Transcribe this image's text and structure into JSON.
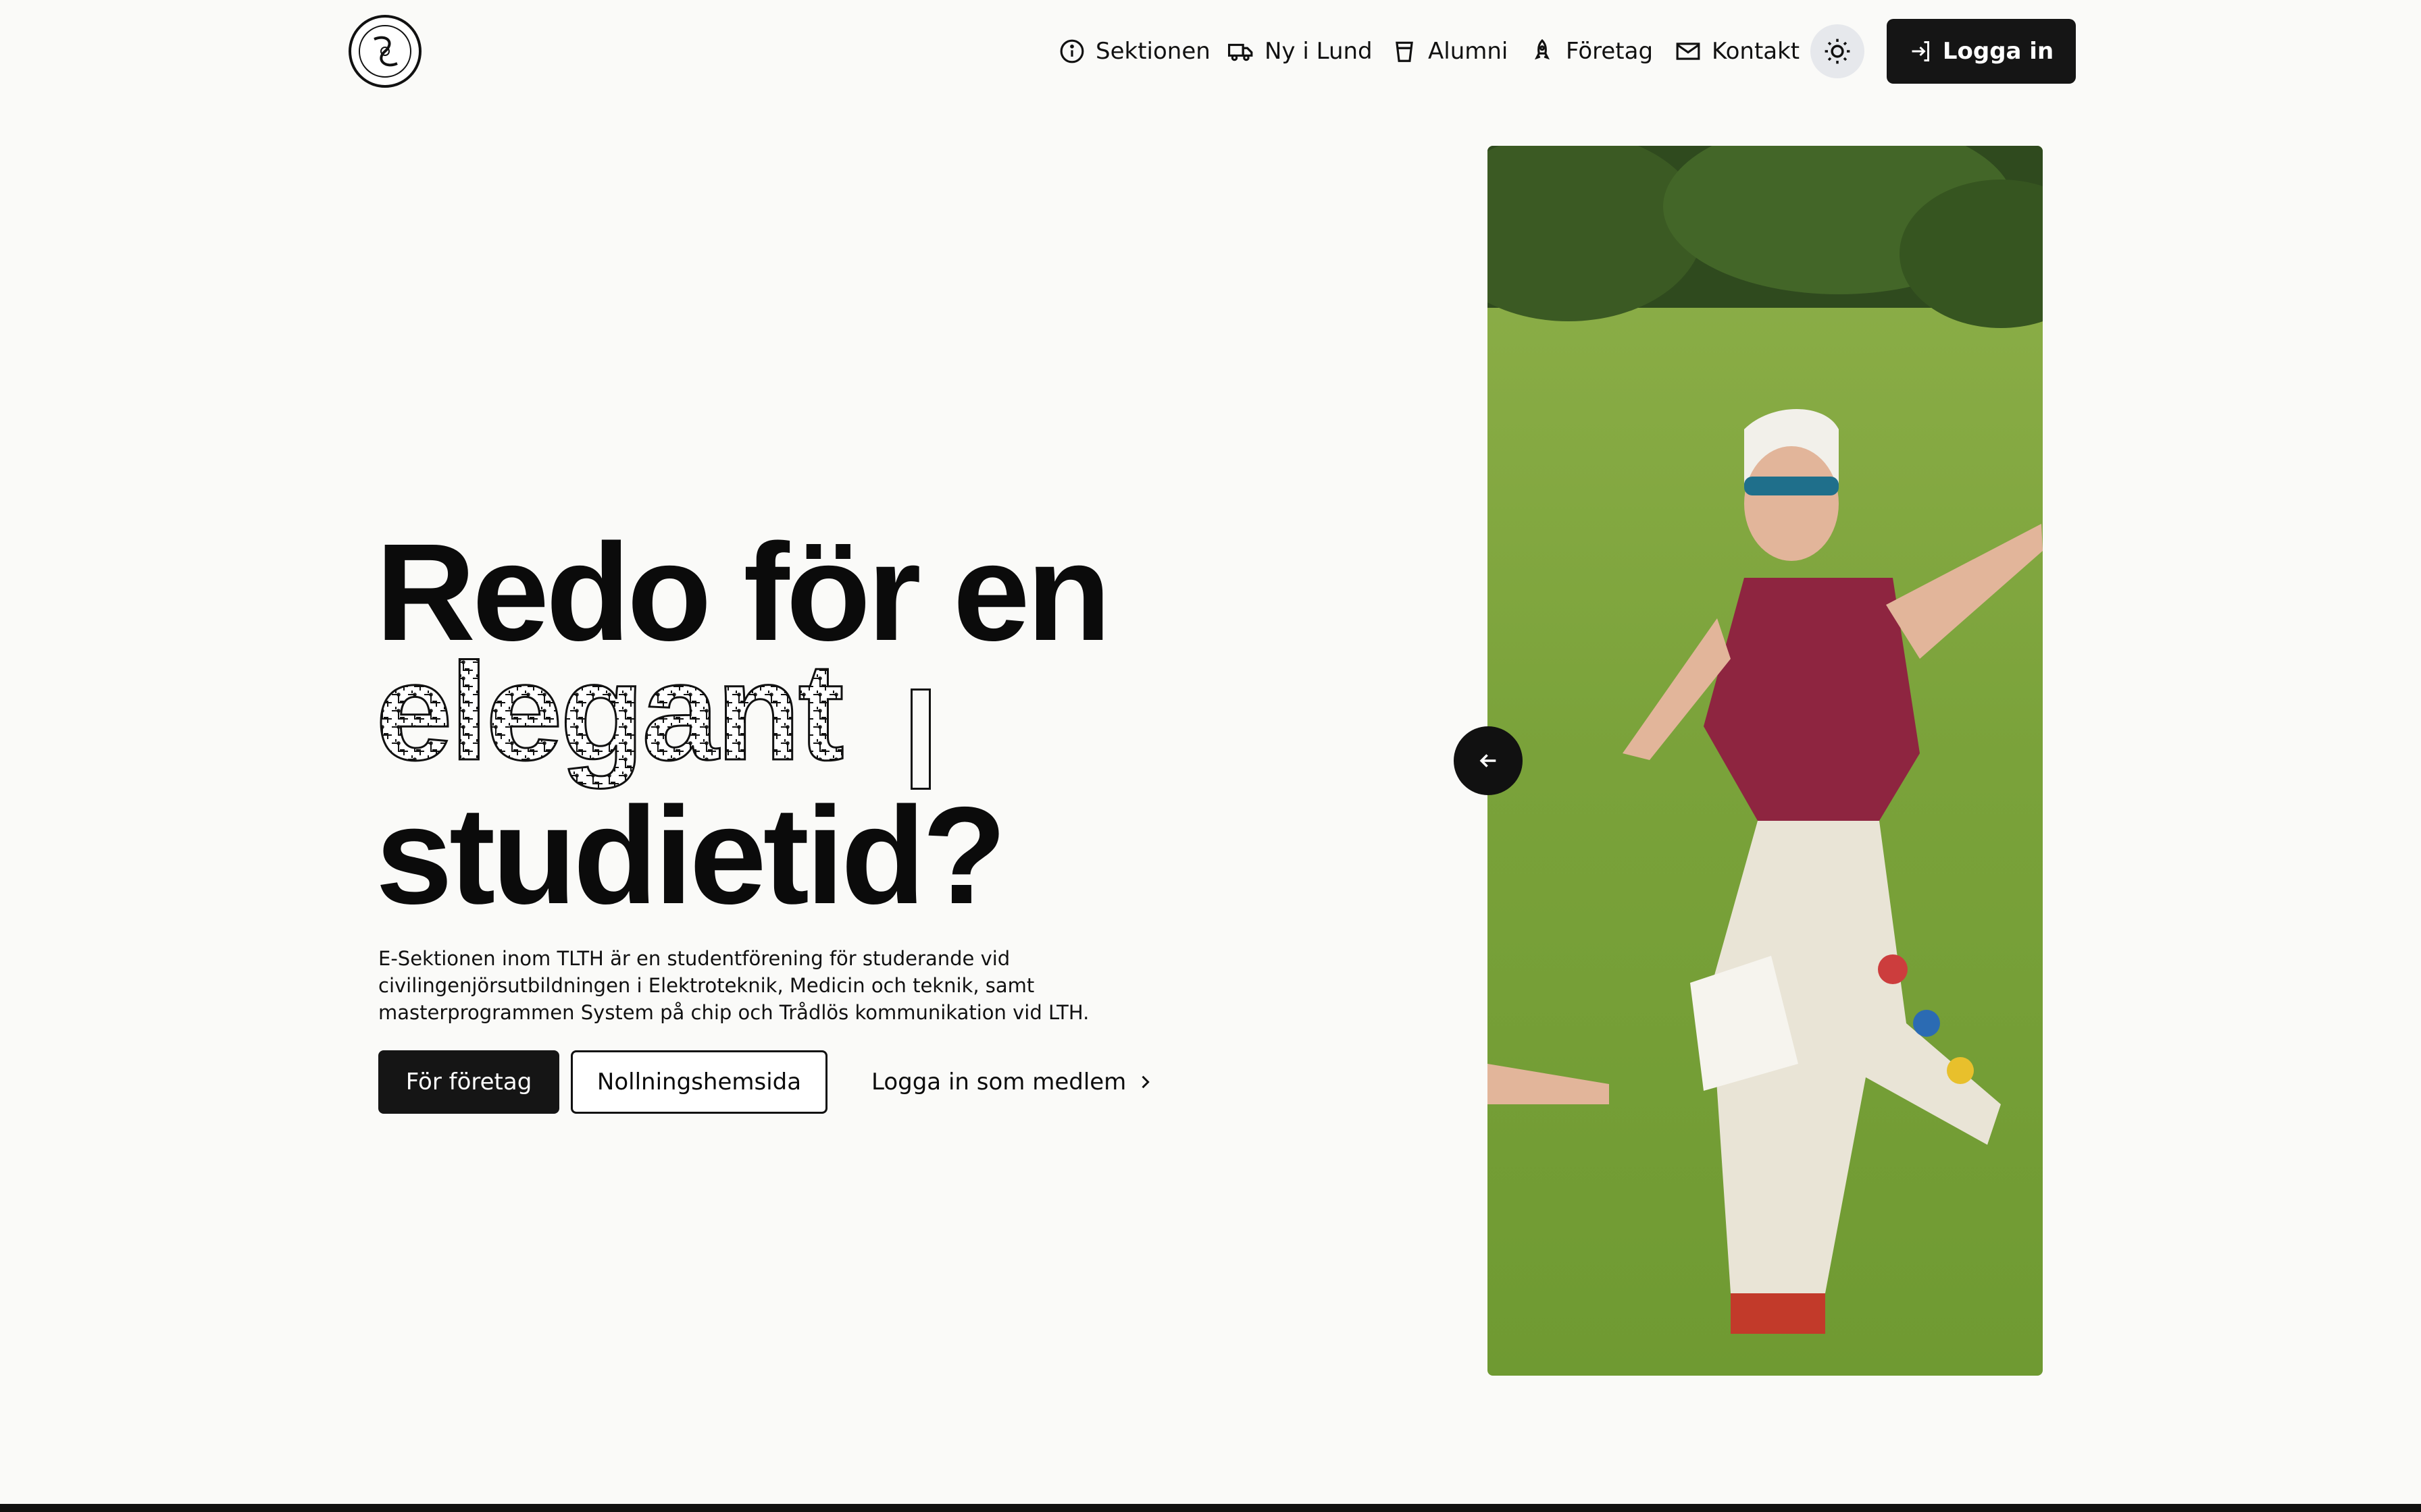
{
  "header": {
    "logo_alt": "E-Sektionen",
    "nav": [
      {
        "label": "Sektionen",
        "icon": "info-icon"
      },
      {
        "label": "Ny i Lund",
        "icon": "truck-icon"
      },
      {
        "label": "Alumni",
        "icon": "cup-icon"
      },
      {
        "label": "Företag",
        "icon": "rocket-icon"
      },
      {
        "label": "Kontakt",
        "icon": "mail-icon"
      }
    ],
    "theme_toggle_icon": "sun-icon",
    "login_label": "Logga in"
  },
  "hero": {
    "headline_line1": "Redo för en",
    "headline_word": "elegant",
    "headline_line3": "studietid?",
    "description": "E-Sektionen inom TLTH är en studentförening för studerande vid civilingenjörsutbildningen i Elektroteknik, Medicin och teknik, samt masterprogrammen System på chip och Trådlös kommunikation vid LTH.",
    "primary_button": "För företag",
    "secondary_button": "Nollningshemsida",
    "link_button": "Logga in som medlem"
  },
  "colors": {
    "background": "#fafaf8",
    "primary": "#151515",
    "grass": "#7fa63e"
  }
}
